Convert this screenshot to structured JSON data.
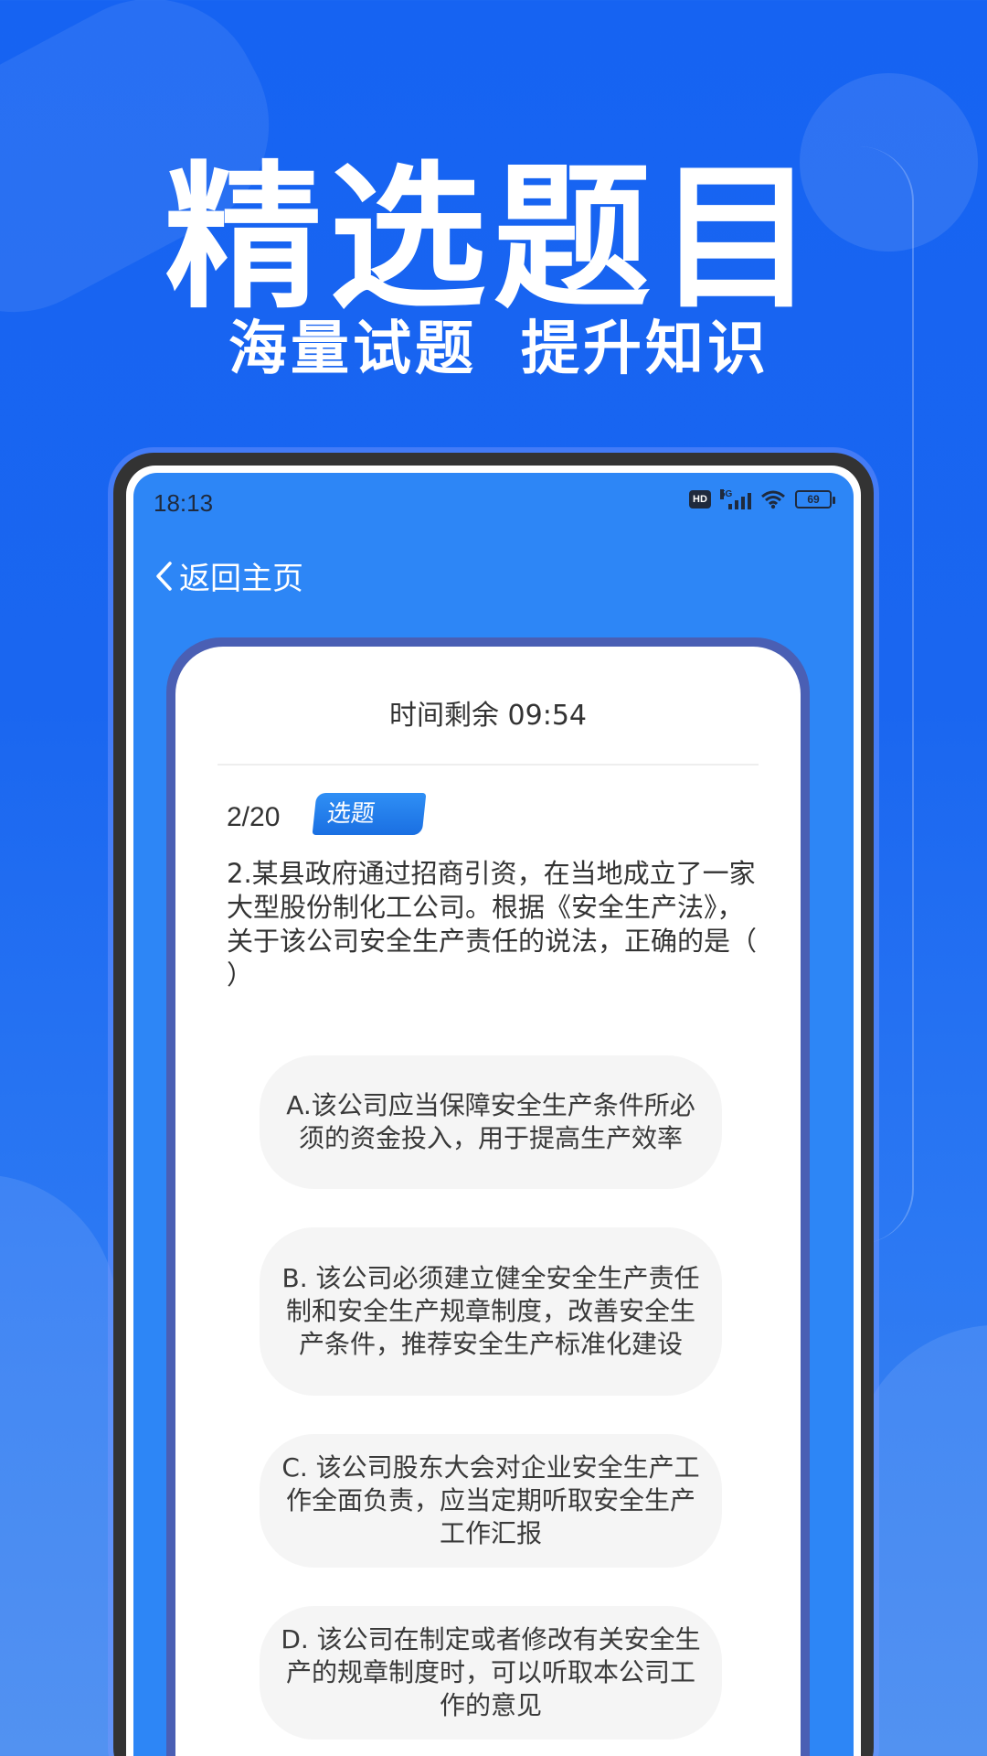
{
  "promo": {
    "headline": "精选题目",
    "sub_left": "海量试题",
    "sub_right": "提升知识"
  },
  "status_bar": {
    "time": "18:13",
    "hd": "HD",
    "network": "5G",
    "battery": "69"
  },
  "nav": {
    "back_label": "返回主页"
  },
  "quiz": {
    "timer": "时间剩余 09:54",
    "progress": "2/20",
    "type_badge": "选题",
    "question": "2.某县政府通过招商引资，在当地成立了一家大型股份制化工公司。根据《安全生产法》，关于该公司安全生产责任的说法，正确的是（　 ）",
    "options": [
      "A.该公司应当保障安全生产条件所必须的资金投入，用于提高生产效率",
      "B. 该公司必须建立健全安全生产责任制和安全生产规章制度，改善安全生产条件，推荐安全生产标准化建设",
      "C. 该公司股东大会对企业安全生产工作全面负责，应当定期听取安全生产工作汇报",
      "D. 该公司在制定或者修改有关安全生产的规章制度时，可以听取本公司工作的意见"
    ]
  },
  "colors": {
    "background": "#1663f2",
    "screen": "#2d86f6",
    "card_border": "#4a5fb4",
    "badge": "#1a6fe2",
    "option_bg": "#f5f5f5"
  }
}
